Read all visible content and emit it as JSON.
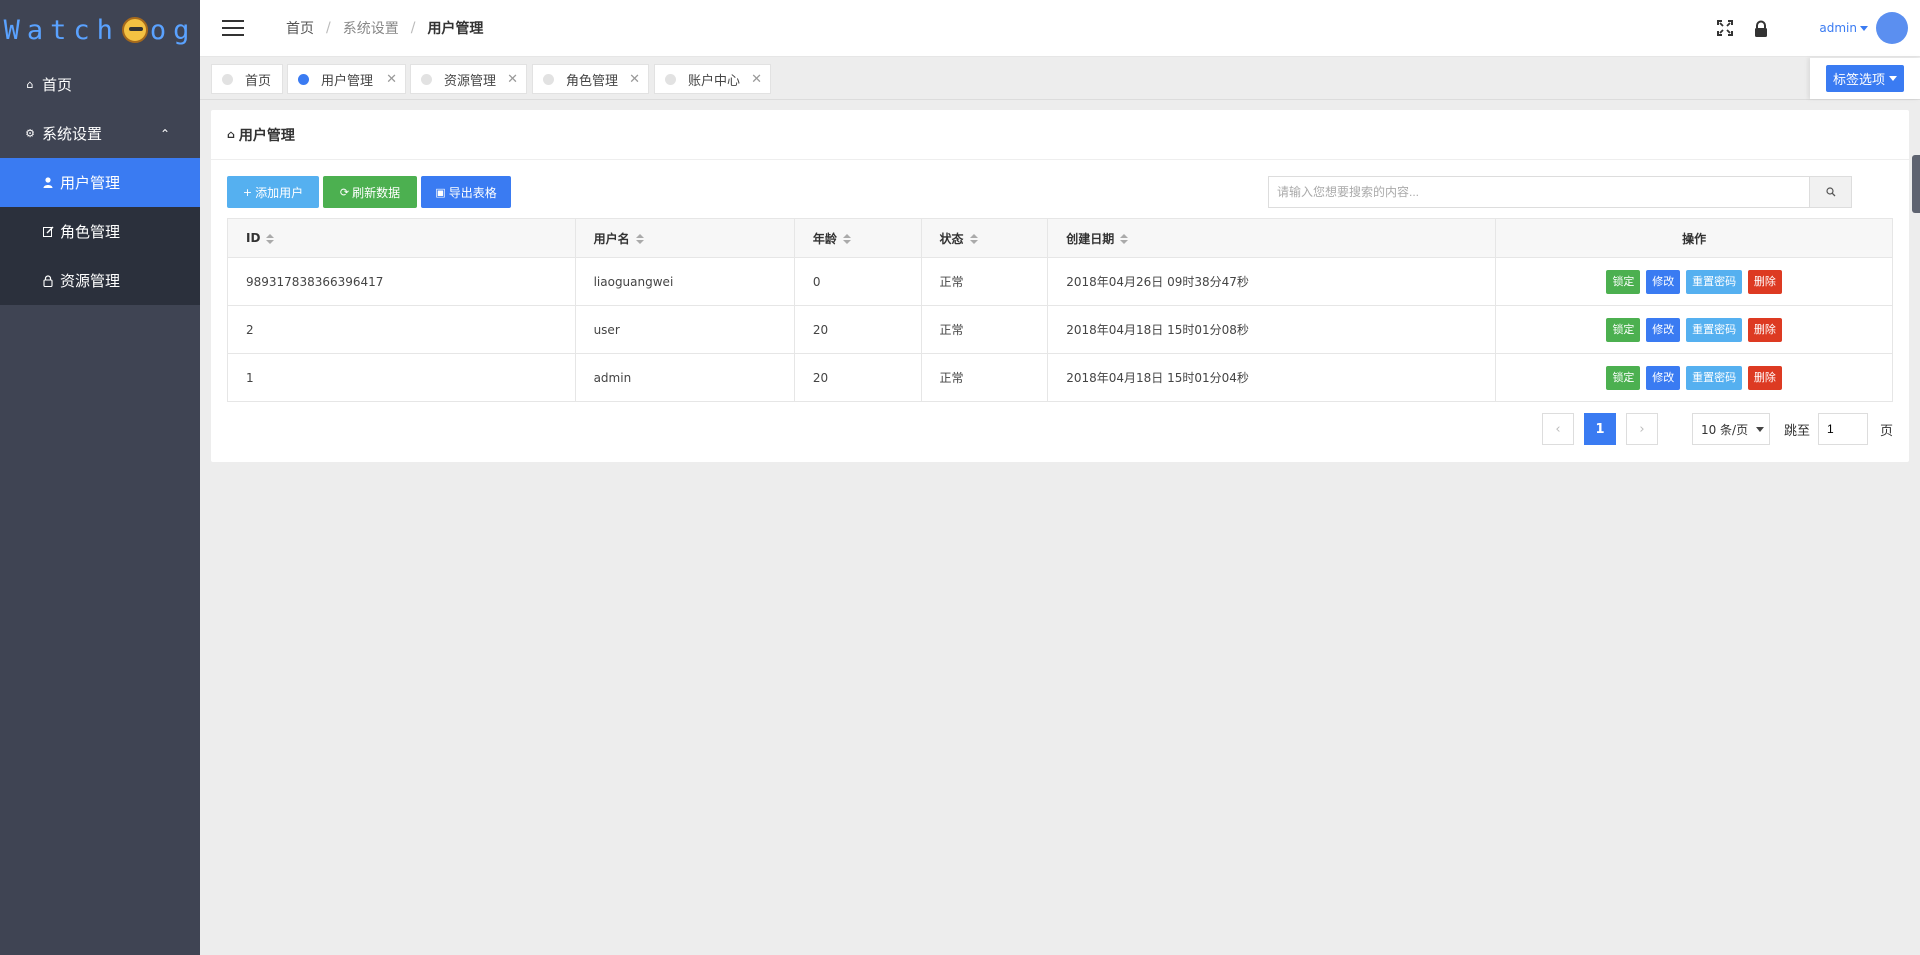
{
  "app": {
    "logo_text_left": "Watch",
    "logo_text_right": "og",
    "logo_icon": "dog-icon"
  },
  "sidebar": {
    "home_label": "首页",
    "group_label": "系统设置",
    "items": [
      {
        "label": "用户管理",
        "icon": "user-icon",
        "active": true
      },
      {
        "label": "角色管理",
        "icon": "edit-icon",
        "active": false
      },
      {
        "label": "资源管理",
        "icon": "lock-icon",
        "active": false
      }
    ]
  },
  "header": {
    "breadcrumb": [
      "首页",
      "系统设置",
      "用户管理"
    ],
    "user_name": "admin",
    "icons": [
      "fullscreen-icon",
      "lock-icon"
    ]
  },
  "tabs": [
    {
      "label": "首页",
      "closable": false,
      "active": false
    },
    {
      "label": "用户管理",
      "closable": true,
      "active": true
    },
    {
      "label": "资源管理",
      "closable": true,
      "active": false
    },
    {
      "label": "角色管理",
      "closable": true,
      "active": false
    },
    {
      "label": "账户中心",
      "closable": true,
      "active": false
    }
  ],
  "tab_options_label": "标签选项",
  "panel": {
    "title": "用户管理"
  },
  "toolbar": {
    "add_label": "添加用户",
    "refresh_label": "刷新数据",
    "export_label": "导出表格"
  },
  "search": {
    "placeholder": "请输入您想要搜索的内容...",
    "value": ""
  },
  "table": {
    "columns": [
      "ID",
      "用户名",
      "年龄",
      "状态",
      "创建日期",
      "操作"
    ],
    "rows": [
      {
        "id": "989317838366396417",
        "username": "liaoguangwei",
        "age": "0",
        "status": "正常",
        "created": "2018年04月26日 09时38分47秒"
      },
      {
        "id": "2",
        "username": "user",
        "age": "20",
        "status": "正常",
        "created": "2018年04月18日 15时01分08秒"
      },
      {
        "id": "1",
        "username": "admin",
        "age": "20",
        "status": "正常",
        "created": "2018年04月18日 15时01分04秒"
      }
    ],
    "actions": {
      "lock": "锁定",
      "edit": "修改",
      "reset": "重置密码",
      "delete": "删除"
    }
  },
  "pagination": {
    "prev": "‹",
    "current": "1",
    "next": "›",
    "page_size": "10 条/页",
    "goto_label": "跳至",
    "goto_value": "1",
    "page_unit": "页"
  },
  "colors": {
    "accent": "#3a7bf2",
    "sidebar_bg": "#3f4453",
    "submenu_bg": "#2b303c",
    "success": "#4cb050",
    "danger": "#dd3a22",
    "info": "#55b0f0"
  }
}
